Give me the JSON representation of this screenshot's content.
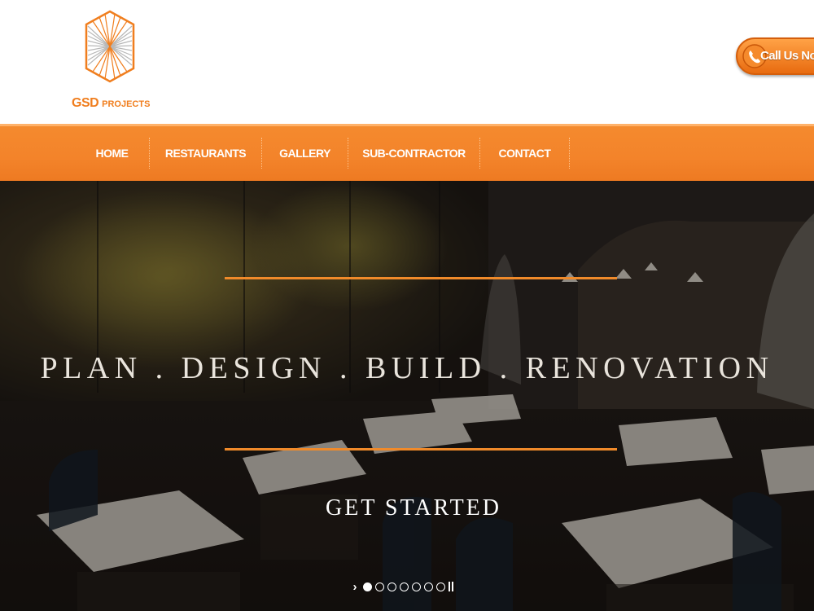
{
  "header": {
    "logo_main": "GSD",
    "logo_sub": "PROJECTS",
    "call_label": "Call Us Now"
  },
  "nav": {
    "items": [
      "HOME",
      "RESTAURANTS",
      "GALLERY",
      "SUB-CONTRACTOR",
      "CONTACT"
    ]
  },
  "hero": {
    "headline": "PLAN . DESIGN . BUILD . RENOVATION",
    "cta": "GET STARTED",
    "slides_total": 7,
    "slide_active": 1
  },
  "colors": {
    "accent": "#f3832a",
    "accent_dark": "#e86b10",
    "logo": "#f07e1e"
  }
}
